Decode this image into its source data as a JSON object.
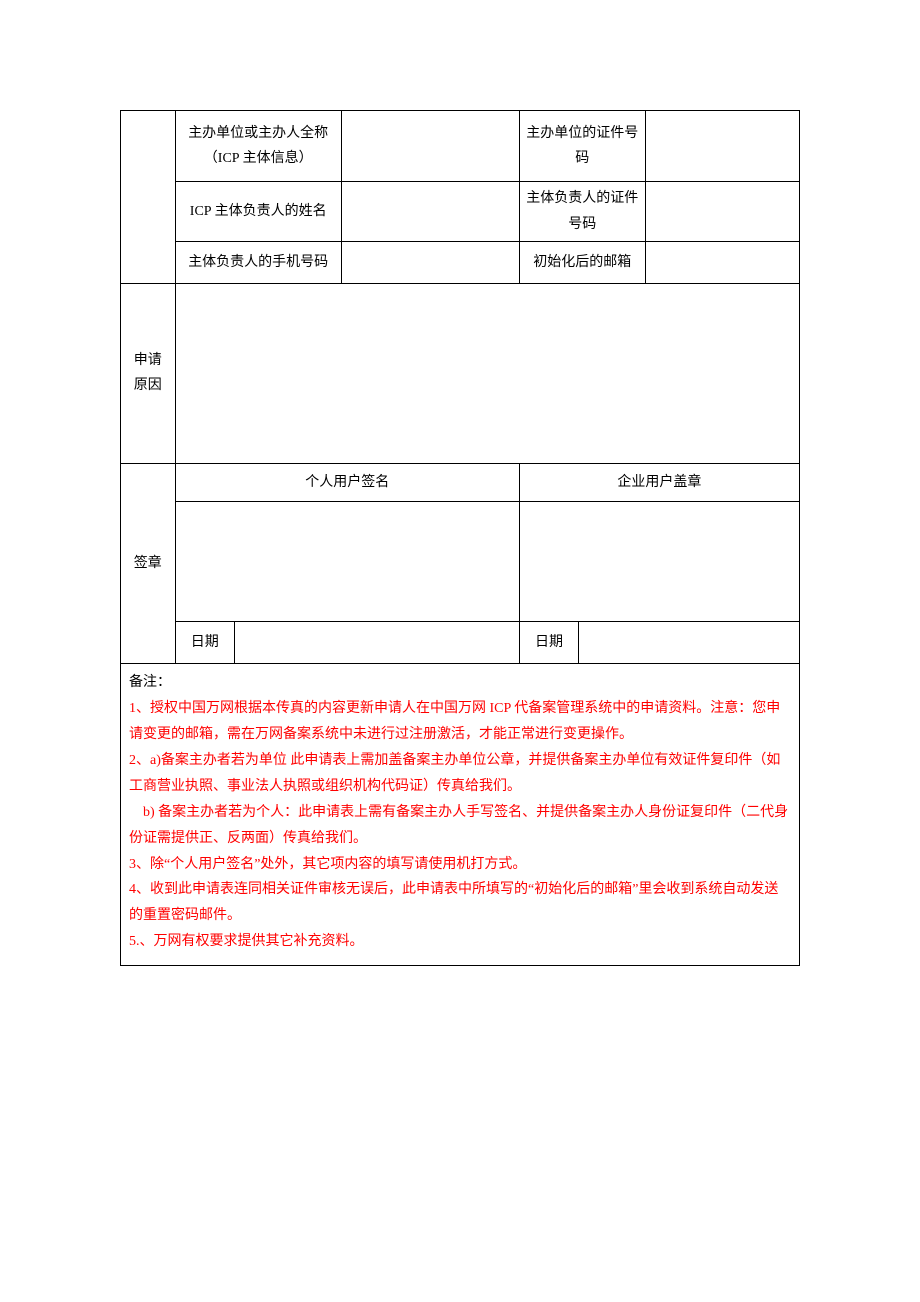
{
  "rows": {
    "r1c1": "",
    "r1c2": "主办单位或主办人全称（ICP 主体信息）",
    "r1c3": "",
    "r1c4": "主办单位的证件号码",
    "r1c5": "",
    "r2c2": "ICP 主体负责人的姓名",
    "r2c3": "",
    "r2c4": "主体负责人的证件号码",
    "r2c5": "",
    "r3c2": "主体负责人的手机号码",
    "r3c3": "",
    "r3c4": "初始化后的邮箱",
    "r3c5": ""
  },
  "section_reason_label": "申请原因",
  "section_reason_value": "",
  "section_sign_label": "签章",
  "sign_personal_header": "个人用户签名",
  "sign_corp_header": "企业用户盖章",
  "date_label": "日期",
  "remarks_title": "备注：",
  "remarks": {
    "n1": "1、授权中国万网根据本传真的内容更新申请人在中国万网 ICP 代备案管理系统中的申请资料。注意：您申请变更的邮箱，需在万网备案系统中未进行过注册激活，才能正常进行变更操作。",
    "n2": "2、a)备案主办者若为单位 此申请表上需加盖备案主办单位公章，并提供备案主办单位有效证件复印件（如工商营业执照、事业法人执照或组织机构代码证）传真给我们。",
    "n2b": "　b)  备案主办者若为个人：此申请表上需有备案主办人手写签名、并提供备案主办人身份证复印件（二代身份证需提供正、反两面）传真给我们。",
    "n3": "3、除“个人用户签名”处外，其它项内容的填写请使用机打方式。",
    "n4": "4、收到此申请表连同相关证件审核无误后，此申请表中所填写的“初始化后的邮箱”里会收到系统自动发送的重置密码邮件。",
    "n5": "5.、万网有权要求提供其它补充资料。"
  }
}
